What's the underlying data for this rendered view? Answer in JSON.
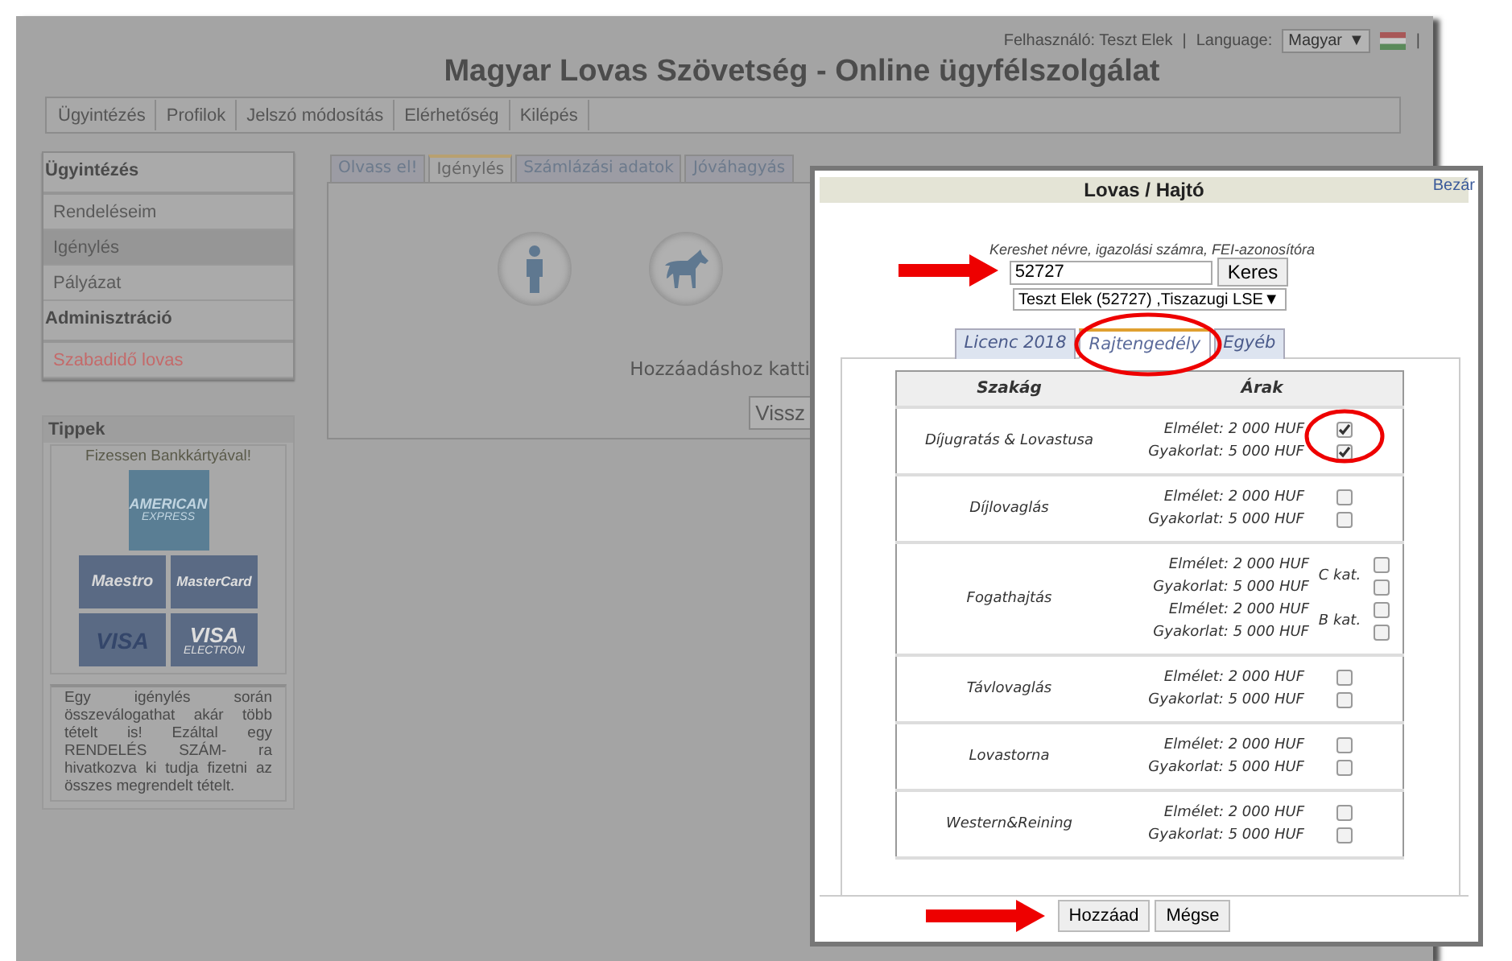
{
  "header": {
    "user": "Felhasználó: Teszt Elek",
    "separator": "|",
    "language_label": "Language:",
    "language_value": "Magyar",
    "language_caret": "▼",
    "trailing_separator": "|"
  },
  "title": "Magyar Lovas Szövetség - Online ügyfélszolgálat",
  "nav": [
    "Ügyintézés",
    "Profilok",
    "Jelszó módosítás",
    "Elérhetőség",
    "Kilépés"
  ],
  "sidebar": {
    "sections": [
      {
        "title": "Ügyintézés",
        "items": [
          {
            "label": "Rendeléseim",
            "selected": false
          },
          {
            "label": "Igénylés",
            "selected": true
          },
          {
            "label": "Pályázat",
            "selected": false
          }
        ]
      },
      {
        "title": "Adminisztráció",
        "items": [
          {
            "label": "Szabadidő lovas",
            "selected": false,
            "kind": "alert"
          }
        ]
      }
    ]
  },
  "tips": {
    "title": "Tippek",
    "caption": "Fizessen Bankkártyával!",
    "cards": [
      {
        "kind": "amex",
        "lines": [
          "AMERICAN",
          "EXPRESS"
        ]
      },
      {
        "kind": "maestro",
        "lines": [
          "Maestro"
        ]
      },
      {
        "kind": "mastercard",
        "lines": [
          "MasterCard"
        ]
      },
      {
        "kind": "visa",
        "lines": [
          "VISA"
        ]
      },
      {
        "kind": "visa-electron",
        "lines": [
          "VISA",
          "ELECTRON"
        ]
      }
    ],
    "note": "Egy igénylés során összeválogathat akár több tételt is! Ezáltal egy RENDELÉS SZÁM- ra hivatkozva ki tudja fizetni az összes megrendelt tételt."
  },
  "main": {
    "tabs": [
      {
        "label": "Olvass el!",
        "selected": false
      },
      {
        "label": "Igénylés",
        "selected": true
      },
      {
        "label": "Számlázási adatok",
        "selected": false
      },
      {
        "label": "Jóváhagyás",
        "selected": false
      }
    ],
    "message": "Hozzáadáshoz katti",
    "back_button": "Vissz"
  },
  "dialog": {
    "title": "Lovas / Hajtó",
    "close": "Bezár",
    "hint": "Kereshet névre, igazolási számra, FEI-azonosítóra",
    "search_value": "52727",
    "search_button": "Keres",
    "person_select": "Teszt Elek (52727) ,Tiszazugi LSE",
    "select_caret": "▼",
    "tabs": [
      {
        "label": "Licenc 2018",
        "selected": false
      },
      {
        "label": "Rajtengedély",
        "selected": true
      },
      {
        "label": "Egyéb",
        "selected": false
      }
    ],
    "columns": [
      "Szakág",
      "Árak"
    ],
    "rows": [
      {
        "name": "Díjugratás & Lovastusa",
        "groups": [
          {
            "prices": [
              {
                "text": "Elmélet: 2 000 HUF",
                "checked": true
              },
              {
                "text": "Gyakorlat: 5 000 HUF",
                "checked": true
              }
            ]
          }
        ]
      },
      {
        "name": "Díjlovaglás",
        "groups": [
          {
            "prices": [
              {
                "text": "Elmélet: 2 000 HUF",
                "checked": false
              },
              {
                "text": "Gyakorlat: 5 000 HUF",
                "checked": false
              }
            ]
          }
        ]
      },
      {
        "name": "Fogathajtás",
        "groups": [
          {
            "category": "C kat.",
            "prices": [
              {
                "text": "Elmélet: 2 000 HUF",
                "checked": false
              },
              {
                "text": "Gyakorlat: 5 000 HUF",
                "checked": false
              }
            ]
          },
          {
            "category": "B kat.",
            "prices": [
              {
                "text": "Elmélet: 2 000 HUF",
                "checked": false
              },
              {
                "text": "Gyakorlat: 5 000 HUF",
                "checked": false
              }
            ]
          }
        ]
      },
      {
        "name": "Távlovaglás",
        "groups": [
          {
            "prices": [
              {
                "text": "Elmélet: 2 000 HUF",
                "checked": false
              },
              {
                "text": "Gyakorlat: 5 000 HUF",
                "checked": false
              }
            ]
          }
        ]
      },
      {
        "name": "Lovastorna",
        "groups": [
          {
            "prices": [
              {
                "text": "Elmélet: 2 000 HUF",
                "checked": false
              },
              {
                "text": "Gyakorlat: 5 000 HUF",
                "checked": false
              }
            ]
          }
        ]
      },
      {
        "name": "Western&Reining",
        "groups": [
          {
            "prices": [
              {
                "text": "Elmélet: 2 000 HUF",
                "checked": false
              },
              {
                "text": "Gyakorlat: 5 000 HUF",
                "checked": false
              }
            ]
          }
        ]
      }
    ],
    "buttons": [
      "Hozzáad",
      "Mégse"
    ]
  }
}
